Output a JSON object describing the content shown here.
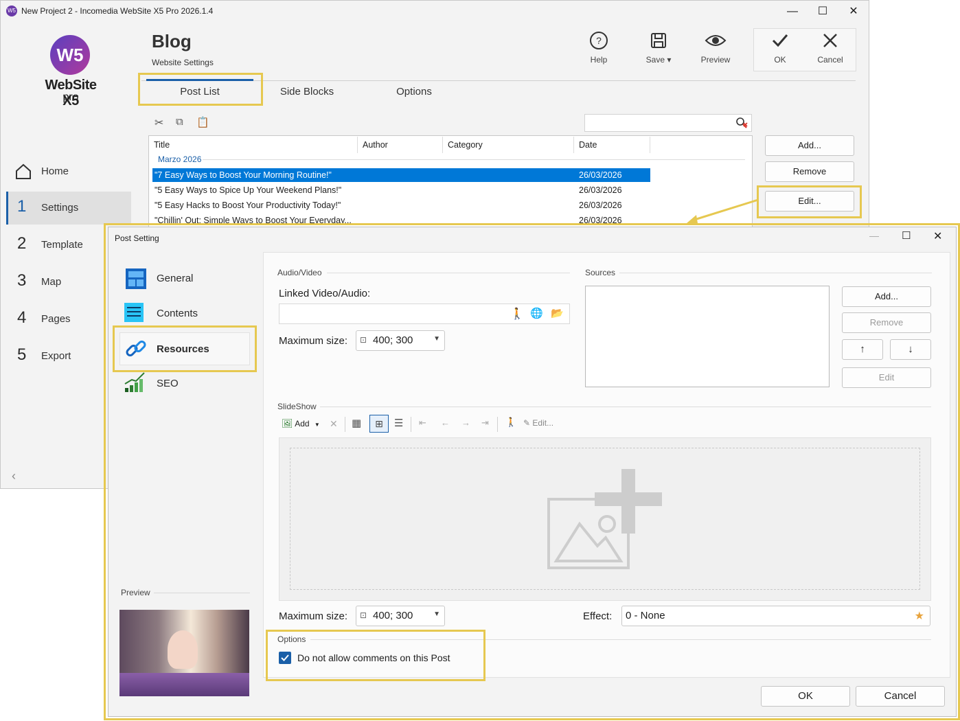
{
  "window": {
    "title": "New Project 2 - Incomedia WebSite X5 Pro 2026.1.4",
    "logo_word": "WebSite X5",
    "logo_sub": "pro"
  },
  "header": {
    "title": "Blog",
    "subtitle": "Website Settings"
  },
  "toolbar": {
    "help": "Help",
    "save": "Save",
    "preview": "Preview",
    "ok": "OK",
    "cancel": "Cancel"
  },
  "sidenav": {
    "items": [
      {
        "num": "",
        "label": "Home"
      },
      {
        "num": "1",
        "label": "Settings"
      },
      {
        "num": "2",
        "label": "Template"
      },
      {
        "num": "3",
        "label": "Map"
      },
      {
        "num": "4",
        "label": "Pages"
      },
      {
        "num": "5",
        "label": "Export"
      }
    ],
    "collapse": "‹"
  },
  "tabs": [
    "Post List",
    "Side Blocks",
    "Options"
  ],
  "postlist": {
    "columns": [
      "Title",
      "Author",
      "Category",
      "Date"
    ],
    "group": "Marzo 2026",
    "rows": [
      {
        "title": "\"7 Easy Ways to Boost Your Morning Routine!\"",
        "date": "26/03/2026"
      },
      {
        "title": "\"5 Easy Ways to Spice Up Your Weekend Plans!\"",
        "date": "26/03/2026"
      },
      {
        "title": "\"5 Easy Hacks to Boost Your Productivity Today!\"",
        "date": "26/03/2026"
      },
      {
        "title": "\"Chillin' Out: Simple Ways to Boost Your Everyday...",
        "date": "26/03/2026"
      }
    ],
    "buttons": {
      "add": "Add...",
      "remove": "Remove",
      "edit": "Edit..."
    }
  },
  "dialog": {
    "title": "Post Setting",
    "nav": [
      "General",
      "Contents",
      "Resources",
      "SEO"
    ],
    "preview_label": "Preview",
    "audio_video": {
      "section": "Audio/Video",
      "linked_label": "Linked Video/Audio:",
      "max_size_label": "Maximum size:",
      "max_size_value": "400; 300"
    },
    "sources": {
      "section": "Sources",
      "add": "Add...",
      "remove": "Remove",
      "up": "↑",
      "down": "↓",
      "edit": "Edit"
    },
    "slideshow": {
      "section": "SlideShow",
      "add": "Add",
      "edit": "Edit...",
      "max_size_label": "Maximum size:",
      "max_size_value": "400; 300",
      "effect_label": "Effect:",
      "effect_value": "0 - None"
    },
    "options": {
      "section": "Options",
      "no_comments": "Do not allow comments on this Post",
      "no_comments_checked": true
    },
    "ok": "OK",
    "cancel": "Cancel"
  },
  "colors": {
    "highlight": "#e6c850",
    "selection": "#0078d7",
    "accent": "#1a5fa8"
  }
}
